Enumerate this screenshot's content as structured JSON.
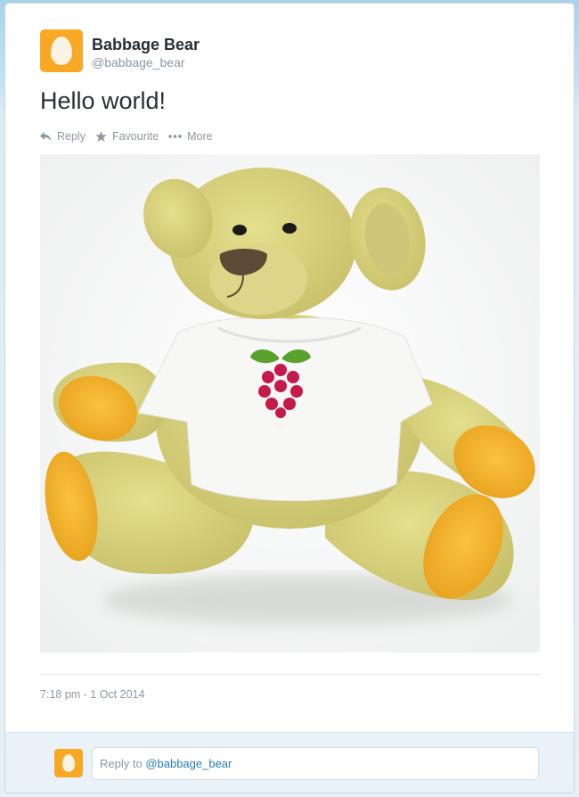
{
  "tweet": {
    "author": {
      "name": "Babbage Bear",
      "handle": "@babbage_bear",
      "avatar_icon": "egg-avatar-icon",
      "avatar_color": "#f9a823"
    },
    "text": "Hello world!",
    "actions": [
      {
        "label": "Reply",
        "icon": "reply-icon"
      },
      {
        "label": "Favourite",
        "icon": "star-icon"
      },
      {
        "label": "More",
        "icon": "more-dots-icon"
      }
    ],
    "image": {
      "icon": "raspberry-pi-logo-icon"
    },
    "timestamp": "7:18 pm - 1 Oct 2014"
  },
  "reply": {
    "prefix": "Reply to ",
    "mention": "@babbage_bear"
  },
  "colors": {
    "text": "#292f33",
    "muted": "#8899a6",
    "link": "#2b7bb9"
  }
}
